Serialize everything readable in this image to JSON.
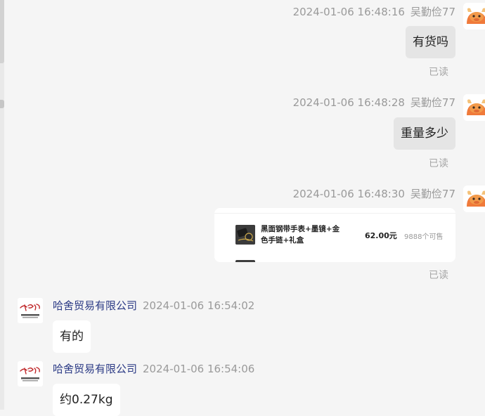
{
  "messages": [
    {
      "time": "2024-01-06 16:48:16",
      "user": "吴勤俭77",
      "text": "有货吗",
      "status": "已读"
    },
    {
      "time": "2024-01-06 16:48:28",
      "user": "吴勤俭77",
      "text": "重量多少",
      "status": "已读"
    },
    {
      "time": "2024-01-06 16:48:30",
      "user": "吴勤俭77",
      "status": "已读",
      "product": {
        "title": "黑面钢带手表+墨镜+金色手链+礼盒",
        "price": "62.00元",
        "availability": "9888个可售"
      }
    },
    {
      "sender": "哈舍贸易有限公司",
      "time": "2024-01-06 16:54:02",
      "text": "有的"
    },
    {
      "sender": "哈舍贸易有限公司",
      "time": "2024-01-06 16:54:06",
      "text": "约0.27kg"
    }
  ],
  "colors": {
    "background": "#f5f5f5",
    "outgoing_bubble": "#e5e5e5",
    "incoming_bubble": "#ffffff",
    "sender_name": "#2b3a85",
    "meta_text": "#9a9a9a"
  },
  "icons": {
    "customer_avatar": "orange-bull-avatar-icon",
    "company_avatar": "company-logo-icon"
  }
}
